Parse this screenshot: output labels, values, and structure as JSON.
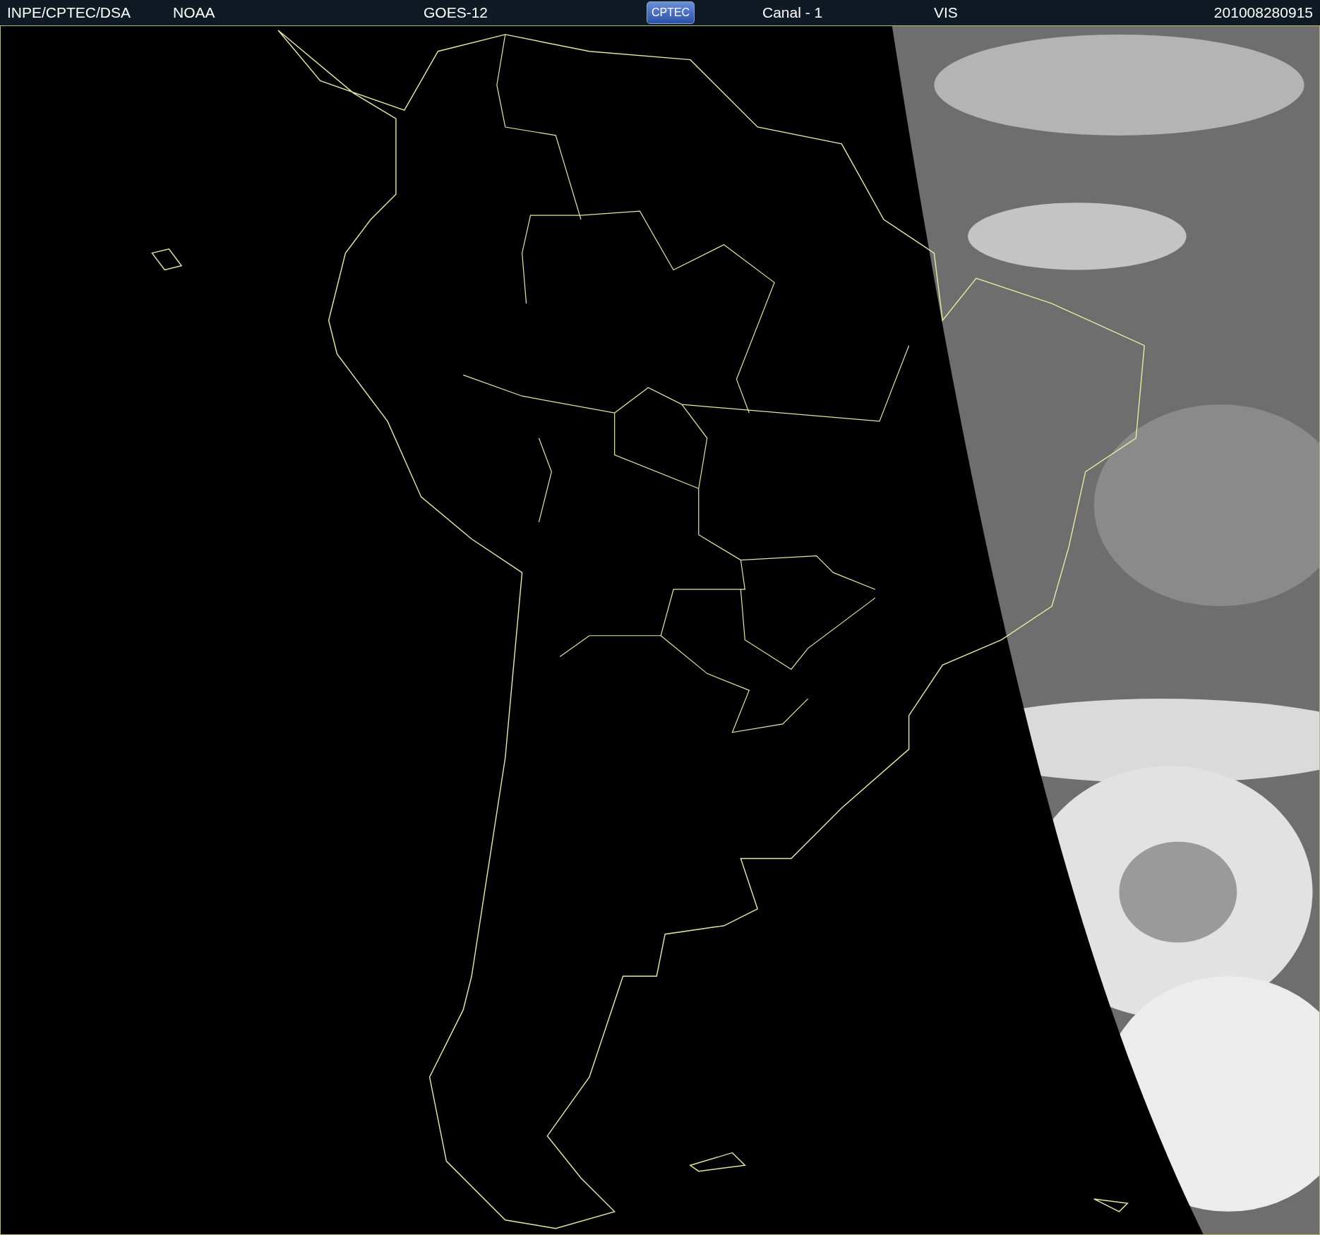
{
  "header": {
    "items": [
      {
        "kind": "text",
        "text": "INPE/CPTEC/DSA"
      },
      {
        "kind": "text",
        "text": "NOAA"
      },
      {
        "kind": "text",
        "text": "GOES-12"
      },
      {
        "kind": "logo",
        "text": "CPTEC"
      },
      {
        "kind": "text",
        "text": "Canal - 1"
      },
      {
        "kind": "text",
        "text": "VIS"
      },
      {
        "kind": "text",
        "text": "201008280915"
      }
    ]
  }
}
